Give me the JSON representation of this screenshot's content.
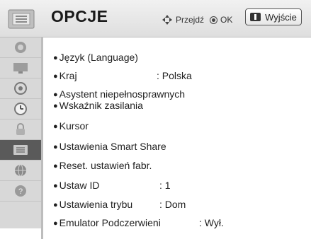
{
  "header": {
    "title": "OPCJE",
    "hint_move": "Przejdź",
    "hint_ok": "OK",
    "exit_label": "Wyjście",
    "exit_key_icon": "exit-key-icon"
  },
  "sidebar": {
    "items": [
      {
        "icon": "picture-icon",
        "active": false
      },
      {
        "icon": "screen-icon",
        "active": false
      },
      {
        "icon": "audio-icon",
        "active": false
      },
      {
        "icon": "clock-icon",
        "active": false
      },
      {
        "icon": "lock-icon",
        "active": false
      },
      {
        "icon": "options-icon",
        "active": true
      },
      {
        "icon": "network-icon",
        "active": false
      },
      {
        "icon": "support-icon",
        "active": false
      }
    ]
  },
  "menu": {
    "items": [
      {
        "label": "Język (Language)",
        "value": ""
      },
      {
        "label": "Kraj",
        "value": ": Polska"
      },
      {
        "label": "Asystent niepełnosprawnych",
        "value": ""
      },
      {
        "label": "Wskaźnik zasilania",
        "value": ""
      },
      {
        "label": "Kursor",
        "value": ""
      },
      {
        "label": "Ustawienia Smart Share",
        "value": ""
      },
      {
        "label": "Reset. ustawień fabr.",
        "value": ""
      },
      {
        "label": "Ustaw ID",
        "value": ": 1"
      },
      {
        "label": "Ustawienia trybu",
        "value": ": Dom"
      },
      {
        "label": "Emulator Podczerwieni",
        "value": ": Wył."
      }
    ]
  },
  "colors": {
    "header_bg": "#e6e6e6",
    "sidebar_bg": "#d8d8d8",
    "sidebar_active": "#5a5a5a",
    "text": "#1f1f1f"
  }
}
